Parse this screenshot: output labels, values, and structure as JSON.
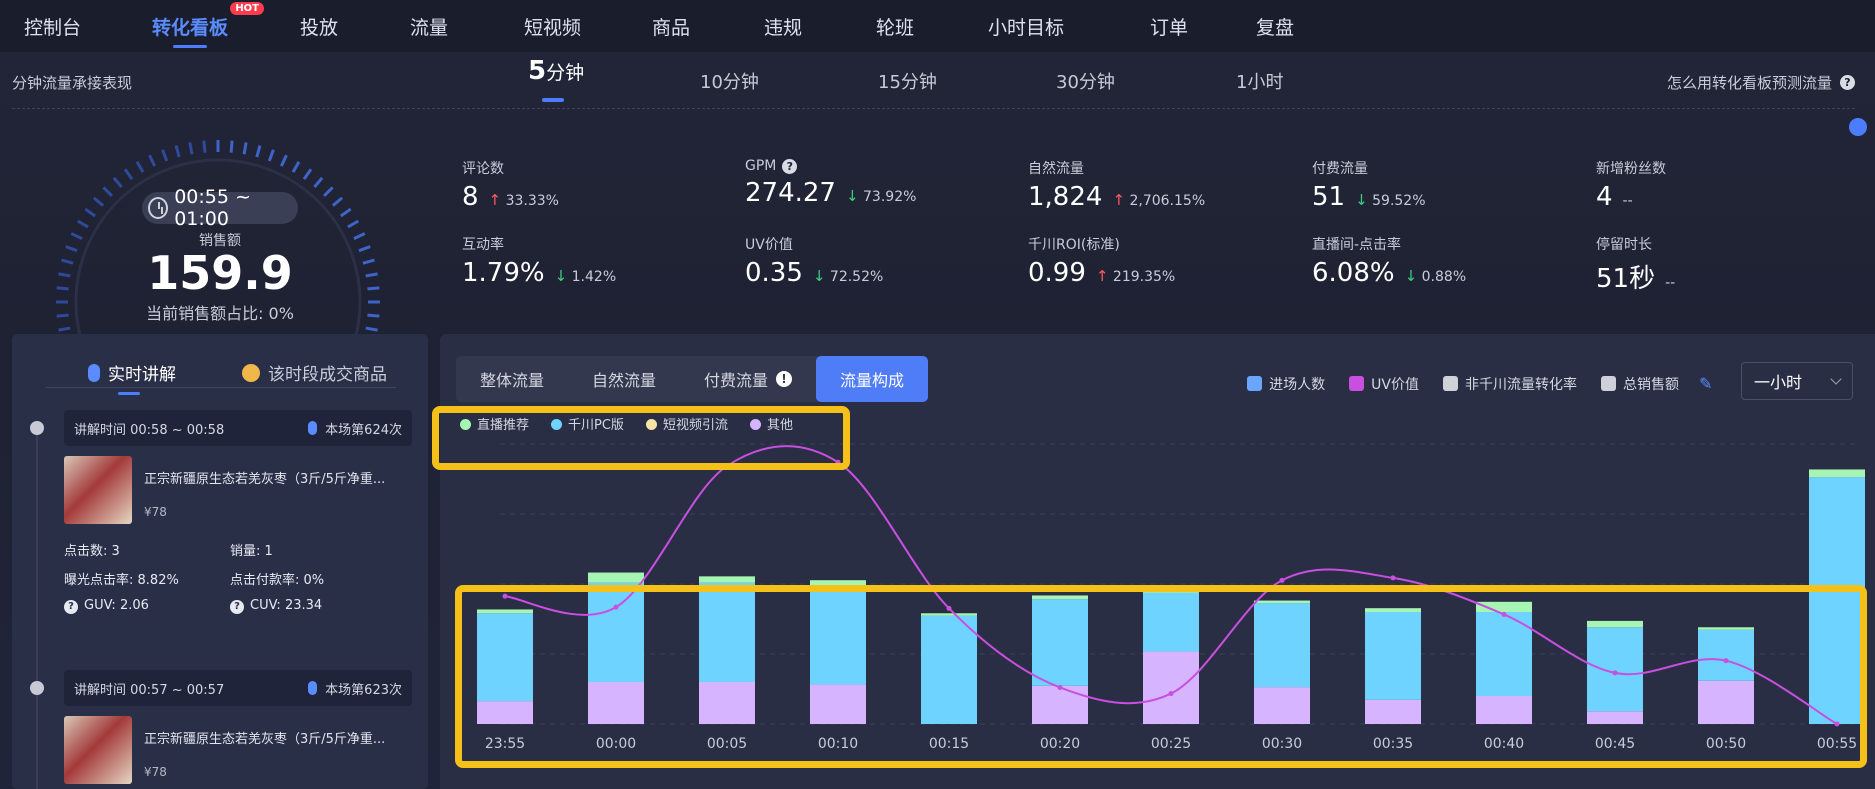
{
  "nav": {
    "items": [
      "控制台",
      "转化看板",
      "投放",
      "流量",
      "短视频",
      "商品",
      "违规",
      "轮班",
      "小时目标",
      "订单",
      "复盘"
    ],
    "active": "转化看板",
    "hot_badge": "HOT"
  },
  "subtitle": "分钟流量承接表现",
  "intervals": [
    {
      "num": "5",
      "unit": "分钟"
    },
    {
      "num": "",
      "unit": "10分钟"
    },
    {
      "num": "",
      "unit": "15分钟"
    },
    {
      "num": "",
      "unit": "30分钟"
    },
    {
      "num": "",
      "unit": "1小时"
    }
  ],
  "help_link": "怎么用转化看板预测流量",
  "gauge": {
    "time_range": "00:55 ~ 01:00",
    "sales_label": "销售额",
    "sales_value": "159.9",
    "sales_share": "当前销售额占比:  0%"
  },
  "metrics": [
    {
      "label": "评论数",
      "value": "8",
      "dir": "up",
      "change": "33.33%"
    },
    {
      "label": "GPM",
      "value": "274.27",
      "dir": "down",
      "change": "73.92%",
      "help": true
    },
    {
      "label": "自然流量",
      "value": "1,824",
      "dir": "up",
      "change": "2,706.15%"
    },
    {
      "label": "付费流量",
      "value": "51",
      "dir": "down",
      "change": "59.52%"
    },
    {
      "label": "新增粉丝数",
      "value": "4",
      "dir": "none",
      "change": "--"
    },
    {
      "label": "互动率",
      "value": "1.79%",
      "dir": "down",
      "change": "1.42%"
    },
    {
      "label": "UV价值",
      "value": "0.35",
      "dir": "down",
      "change": "72.52%"
    },
    {
      "label": "千川ROI(标准)",
      "value": "0.99",
      "dir": "up",
      "change": "219.35%"
    },
    {
      "label": "直播间-点击率",
      "value": "6.08%",
      "dir": "down",
      "change": "0.88%"
    },
    {
      "label": "停留时长",
      "value": "51秒",
      "dir": "none",
      "change": "--"
    }
  ],
  "left_panel": {
    "tab_live": "实时讲解",
    "tab_products": "该时段成交商品",
    "cards": [
      {
        "time": "讲解时间 00:58 ~ 00:58",
        "count": "本场第624次",
        "product": "正宗新疆原生态若羌灰枣（3斤/5斤净重...",
        "price": "¥78",
        "stats": [
          [
            "点击数:",
            "3"
          ],
          [
            "销量:",
            "1"
          ],
          [
            "曝光点击率:",
            "8.82%"
          ],
          [
            "点击付款率:",
            "0%"
          ],
          [
            "GUV:",
            "2.06"
          ],
          [
            "CUV:",
            "23.34"
          ]
        ]
      },
      {
        "time": "讲解时间 00:57 ~ 00:57",
        "count": "本场第623次",
        "product": "正宗新疆原生态若羌灰枣（3斤/5斤净重...",
        "price": "¥78"
      }
    ]
  },
  "right_panel": {
    "tabs": [
      "整体流量",
      "自然流量",
      "付费流量",
      "流量构成"
    ],
    "active_tab": "流量构成",
    "legend": [
      {
        "label": "进场人数",
        "color": "#6aa6ff"
      },
      {
        "label": "UV价值",
        "color": "#c94fe0"
      },
      {
        "label": "非千川流量转化率",
        "color": "#cfd1d8"
      },
      {
        "label": "总销售额",
        "color": "#cfd1d8"
      }
    ],
    "select_value": "一小时",
    "source_legend": [
      {
        "label": "直播推荐",
        "color": "#a6f5b2"
      },
      {
        "label": "千川PC版",
        "color": "#6fd3ff"
      },
      {
        "label": "短视频引流",
        "color": "#f7e3a6"
      },
      {
        "label": "其他",
        "color": "#d6b4ff"
      }
    ]
  },
  "chart_data": {
    "type": "bar",
    "categories": [
      "23:55",
      "00:00",
      "00:05",
      "00:10",
      "00:15",
      "00:20",
      "00:25",
      "00:30",
      "00:35",
      "00:40",
      "00:45",
      "00:50",
      "00:55"
    ],
    "series": [
      {
        "name": "其他",
        "values": [
          18,
          33,
          33,
          31,
          0,
          30,
          57,
          29,
          19,
          22,
          10,
          34,
          0
        ]
      },
      {
        "name": "千川PC版",
        "values": [
          69,
          78,
          78,
          76,
          85,
          68,
          46,
          66,
          69,
          66,
          66,
          40,
          194
        ]
      },
      {
        "name": "直播推荐",
        "values": [
          3,
          8,
          5,
          6,
          2,
          3,
          6,
          2,
          3,
          8,
          5,
          2,
          6
        ]
      }
    ],
    "line": {
      "name": "UV价值",
      "values": [
        105,
        96,
        212,
        215,
        95,
        30,
        25,
        118,
        120,
        90,
        42,
        52,
        0
      ]
    },
    "ylim": [
      0,
      220
    ],
    "line_ylim": [
      0,
      230
    ]
  }
}
